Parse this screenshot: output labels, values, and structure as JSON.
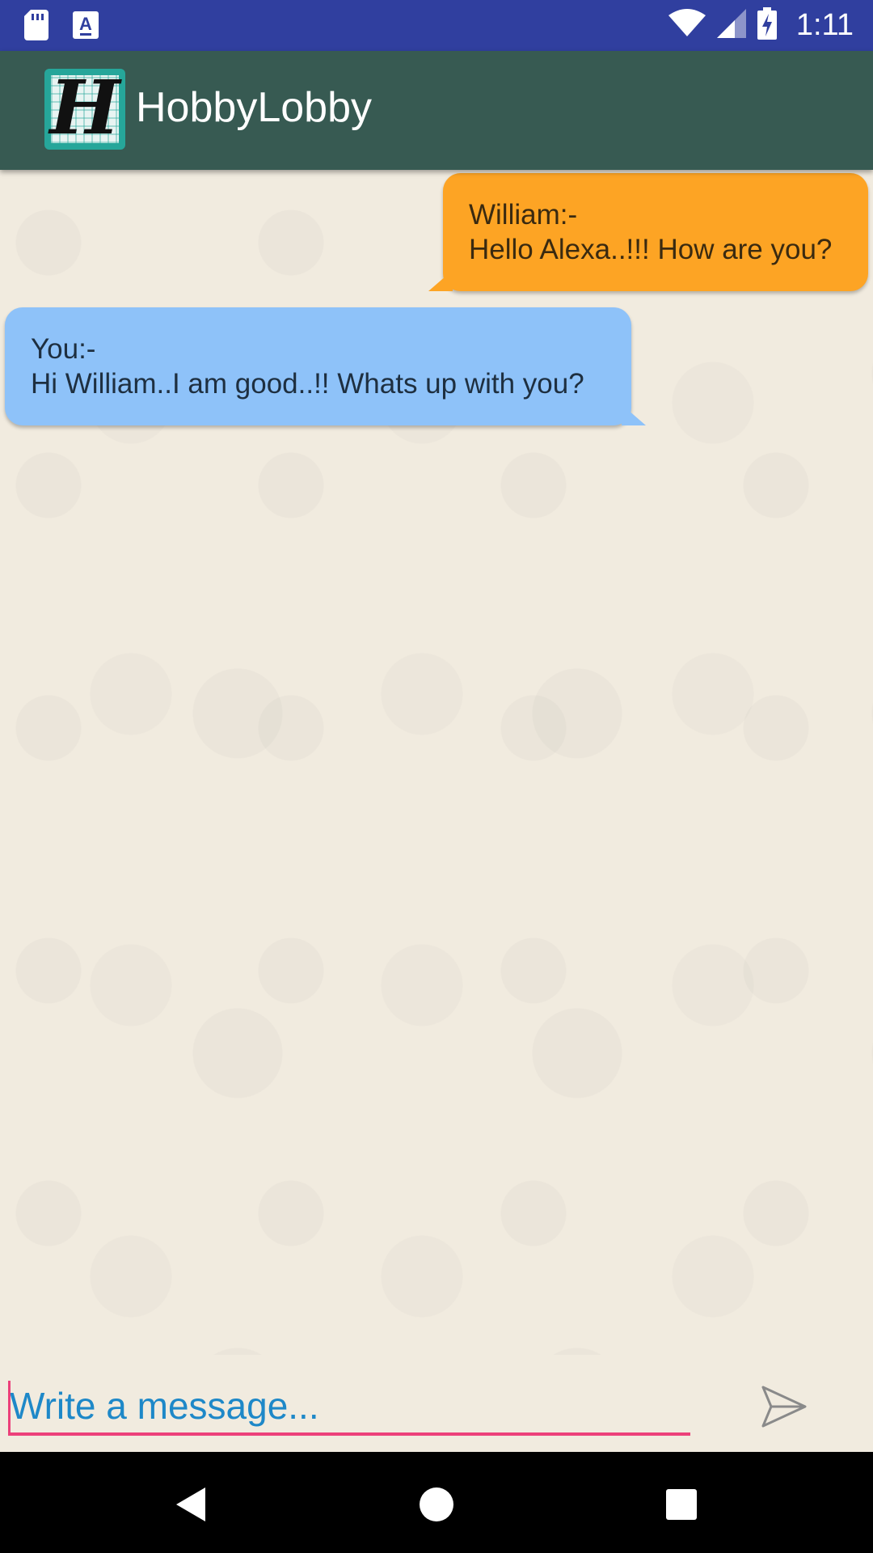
{
  "status_bar": {
    "time": "1:11",
    "icons": [
      "sd-card-icon",
      "a-notification-icon",
      "wifi-icon",
      "signal-icon",
      "battery-charging-icon"
    ]
  },
  "app_bar": {
    "title": "HobbyLobby",
    "logo_letter": "H",
    "background": "#375a52"
  },
  "messages": [
    {
      "side": "incoming",
      "sender": "William:-",
      "text": "Hello Alexa..!!! How are you?",
      "color": "#fda424"
    },
    {
      "side": "outgoing",
      "sender": "You:-",
      "text": "Hi William..I am good..!! Whats up with you?",
      "color": "#8ec2f9"
    }
  ],
  "composer": {
    "placeholder": "Write a message...",
    "value": "",
    "send_icon": "send-icon"
  },
  "nav_bar": {
    "icons": [
      "back-icon",
      "home-icon",
      "recents-icon"
    ]
  }
}
